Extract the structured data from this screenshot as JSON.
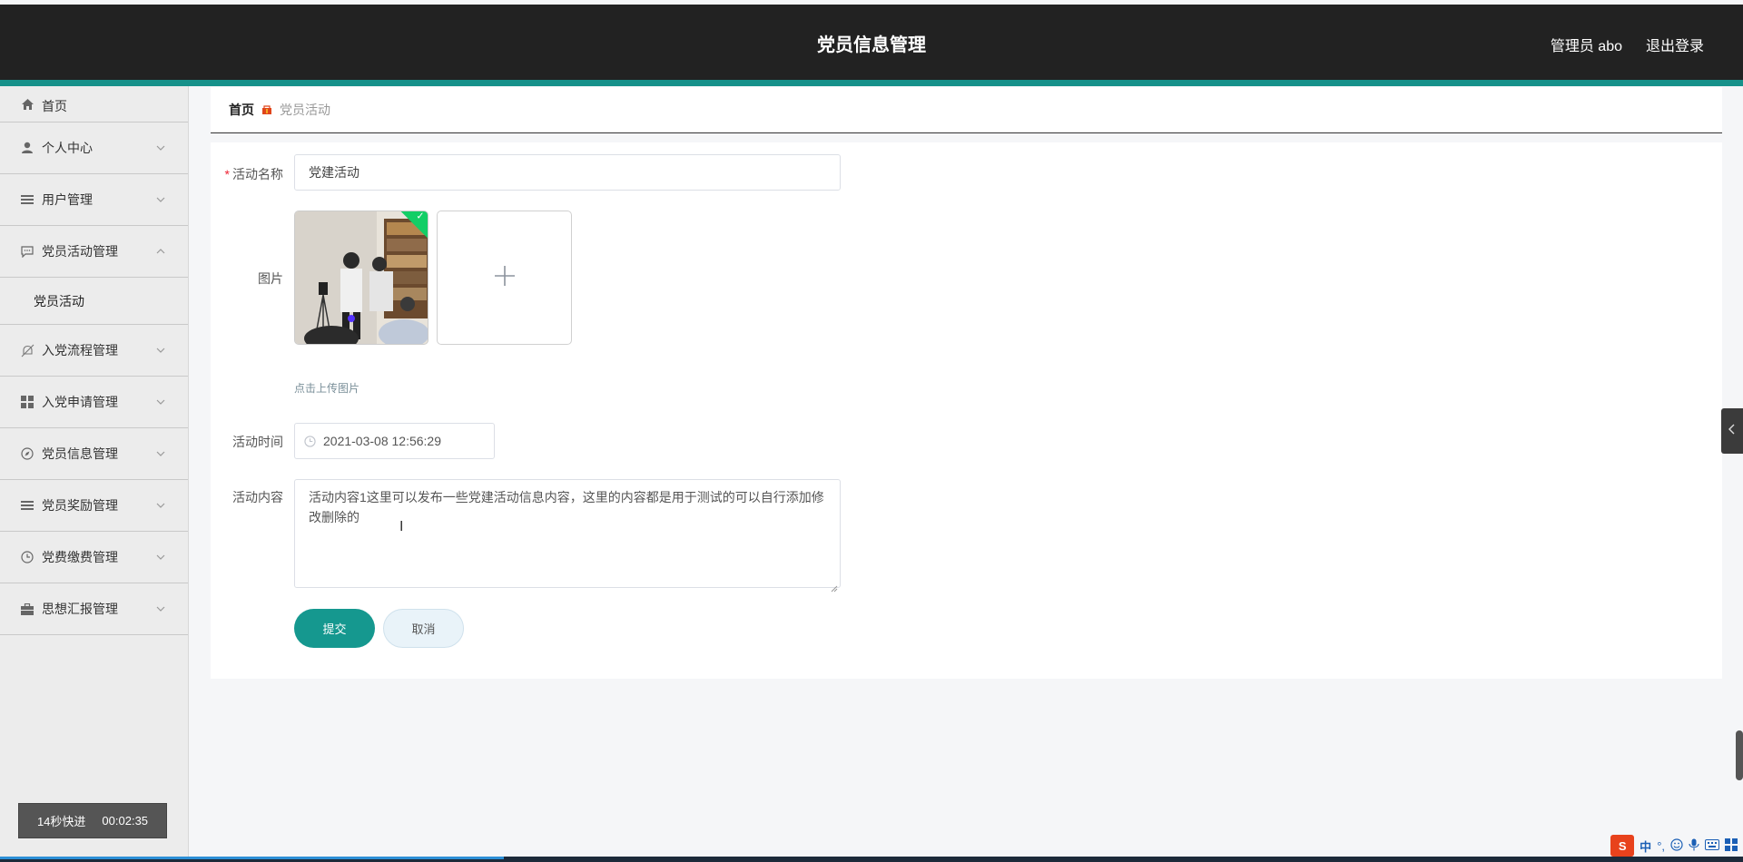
{
  "header": {
    "title": "党员信息管理",
    "user": "管理员 abo",
    "logout": "退出登录"
  },
  "sidebar": {
    "items": [
      {
        "label": "首页",
        "icon": "home-icon"
      },
      {
        "label": "个人中心",
        "icon": "user-icon"
      },
      {
        "label": "用户管理",
        "icon": "list-icon"
      },
      {
        "label": "党员活动管理",
        "icon": "chat-icon",
        "expanded": true,
        "children": [
          "党员活动"
        ]
      },
      {
        "label": "入党流程管理",
        "icon": "bell-off-icon"
      },
      {
        "label": "入党申请管理",
        "icon": "grid-icon"
      },
      {
        "label": "党员信息管理",
        "icon": "compass-icon"
      },
      {
        "label": "党员奖励管理",
        "icon": "list-icon"
      },
      {
        "label": "党费缴费管理",
        "icon": "clock-icon"
      },
      {
        "label": "思想汇报管理",
        "icon": "briefcase-icon"
      }
    ],
    "footer": {
      "speed": "14秒快进",
      "timer": "00:02:35"
    }
  },
  "breadcrumb": {
    "home": "首页",
    "current": "党员活动"
  },
  "form": {
    "name_label": "活动名称",
    "name_value": "党建活动",
    "image_label": "图片",
    "upload_hint": "点击上传图片",
    "time_label": "活动时间",
    "time_value": "2021-03-08 12:56:29",
    "content_label": "活动内容",
    "content_value": "活动内容1这里可以发布一些党建活动信息内容，这里的内容都是用于测试的可以自行添加修改删除的",
    "submit": "提交",
    "cancel": "取消"
  },
  "ime": {
    "logo": "S",
    "lang": "中",
    "marks": "°,"
  },
  "colors": {
    "header_bg": "#222222",
    "accent": "#16918a",
    "submit_bg": "#15988f",
    "success": "#13ce66"
  }
}
